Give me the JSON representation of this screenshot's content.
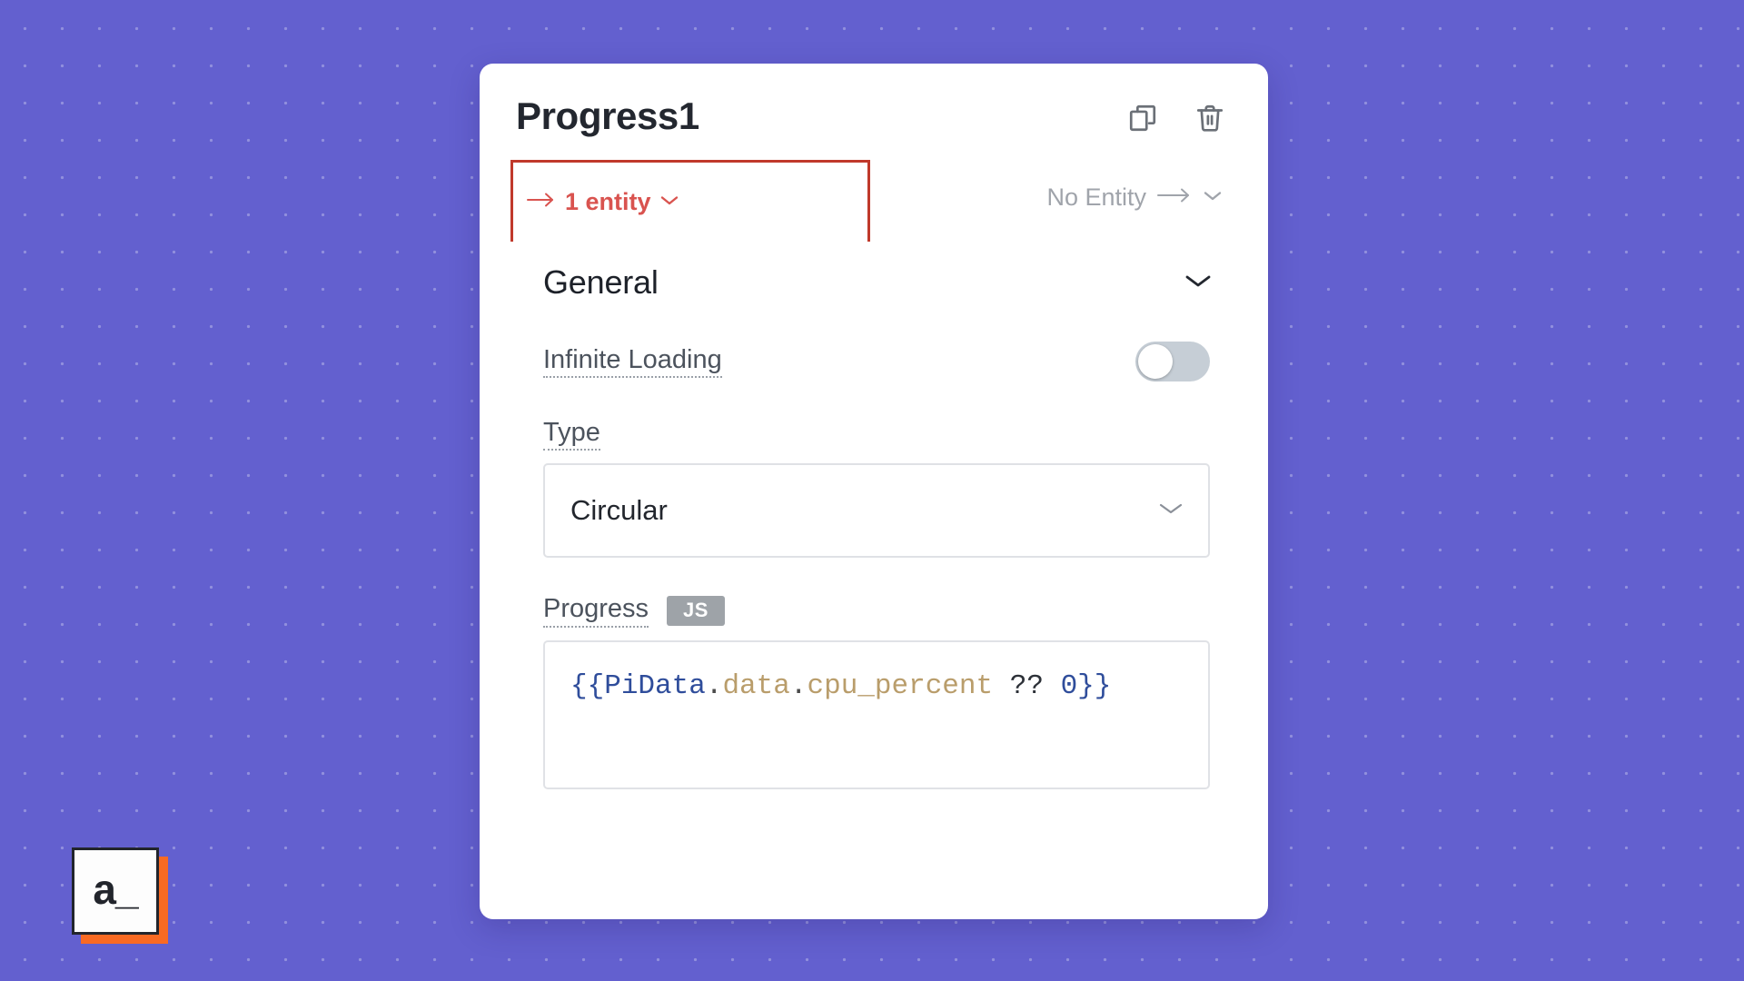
{
  "canvas": {
    "background_color": "#6360cf",
    "dot_color": "#ffffff"
  },
  "logo": {
    "text": "a_",
    "shadow_color": "#f96a23",
    "face_color": "#fdfdfd"
  },
  "panel": {
    "title": "Progress1",
    "actions": [
      {
        "name": "copy-widget",
        "icon": "copy-icon"
      },
      {
        "name": "delete-widget",
        "icon": "trash-icon"
      }
    ],
    "entity_bar": {
      "selected": {
        "label": "1 entity",
        "color": "#d9534f",
        "border_color": "#c0392b",
        "leading_icon": "arrow-right-icon",
        "trailing_icon": "chevron-down-icon"
      },
      "connections": {
        "label": "No Entity",
        "color": "#a0a4ab",
        "leading_icon": "arrow-right-icon",
        "trailing_icon": "chevron-down-icon"
      }
    },
    "sections": [
      {
        "title": "General",
        "collapsed": false,
        "toggle_icon": "chevron-down-icon",
        "fields": [
          {
            "kind": "switch",
            "label": "Infinite Loading",
            "value": "off",
            "track_color": "#c6ced6"
          },
          {
            "kind": "select",
            "label": "Type",
            "value": "Circular",
            "chevron_icon": "chevron-down-icon"
          },
          {
            "kind": "code",
            "label": "Progress",
            "badge": "JS",
            "badge_color": "#9ea3a8",
            "value": "{{PiData.data.cpu_percent ?? 0}}",
            "tokens": {
              "open_brace": "{{",
              "identifier": "PiData",
              "dot1": ".",
              "prop1": "data",
              "dot2": ".",
              "prop2": "cpu_percent",
              "operator": "??",
              "number": "0",
              "close_brace": "}}"
            }
          }
        ]
      }
    ]
  }
}
